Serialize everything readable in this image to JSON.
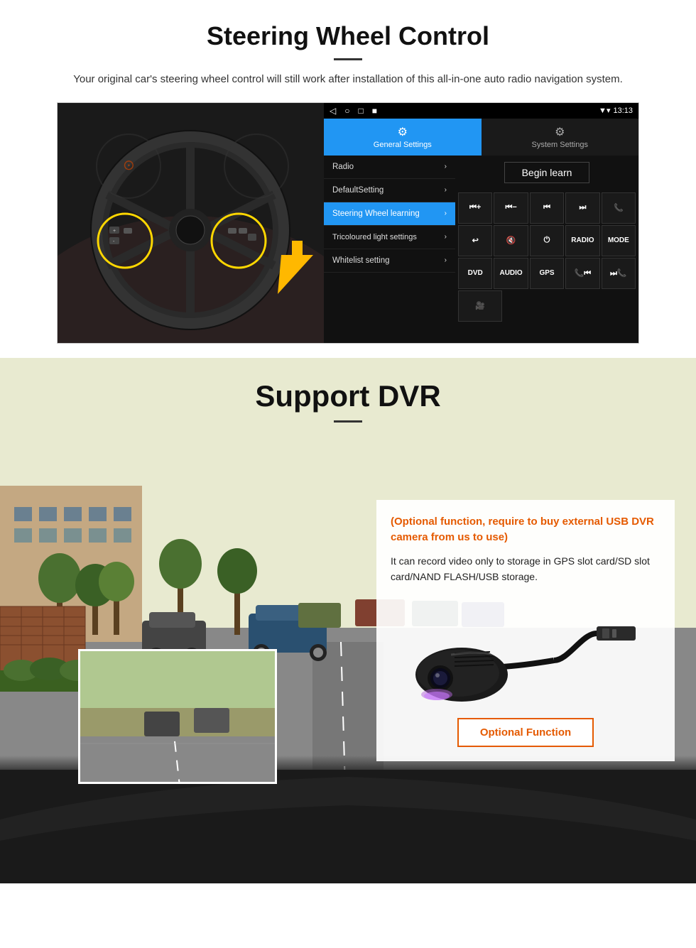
{
  "steering": {
    "title": "Steering Wheel Control",
    "subtitle": "Your original car's steering wheel control will still work after installation of this all-in-one auto radio navigation system.",
    "status_bar": {
      "time": "13:13",
      "nav_icons": [
        "◁",
        "○",
        "□",
        "■"
      ]
    },
    "tabs": [
      {
        "id": "general",
        "icon": "⚙",
        "label": "General Settings",
        "active": true
      },
      {
        "id": "system",
        "icon": "🔧",
        "label": "System Settings",
        "active": false
      }
    ],
    "menu_items": [
      {
        "label": "Radio",
        "active": false
      },
      {
        "label": "DefaultSetting",
        "active": false
      },
      {
        "label": "Steering Wheel learning",
        "active": true
      },
      {
        "label": "Tricoloured light settings",
        "active": false
      },
      {
        "label": "Whitelist setting",
        "active": false
      }
    ],
    "begin_learn": "Begin learn",
    "control_buttons": [
      [
        "⏮+",
        "⏮-",
        "⏭⏮",
        "⏭⏭",
        "📞"
      ],
      [
        "↩",
        "🔇",
        "⏻",
        "RADIO",
        "MODE"
      ],
      [
        "DVD",
        "AUDIO",
        "GPS",
        "📞⏮",
        "⏭📞"
      ],
      [
        "🎥"
      ]
    ]
  },
  "dvr": {
    "title": "Support DVR",
    "optional_highlight": "(Optional function, require to buy external USB DVR camera from us to use)",
    "description": "It can record video only to storage in GPS slot card/SD slot card/NAND FLASH/USB storage.",
    "optional_function_label": "Optional Function"
  }
}
